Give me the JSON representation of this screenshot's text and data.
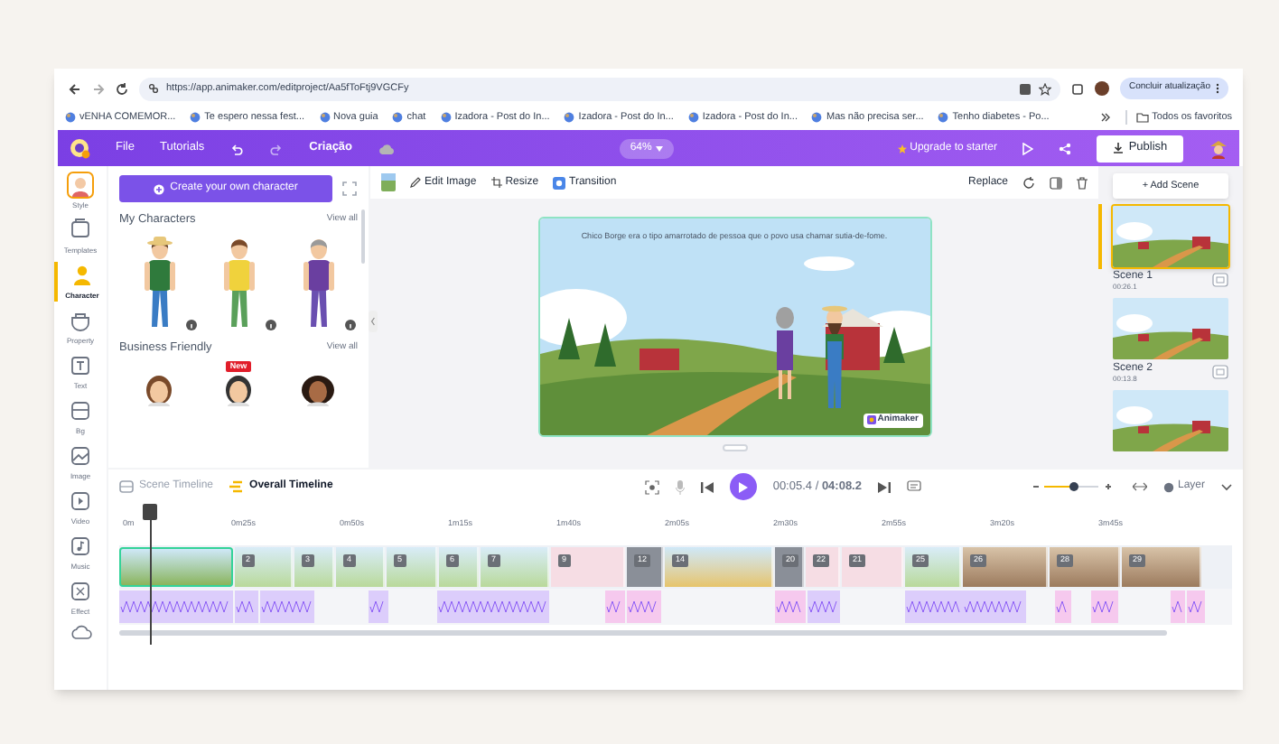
{
  "browser": {
    "url": "https://app.animaker.com/editproject/Aa5fToFtj9VGCFy",
    "update_button": "Concluir atualização",
    "bookmarks": [
      {
        "label": "vENHA COMEMOR..."
      },
      {
        "label": "Te espero nessa fest..."
      },
      {
        "label": "Nova guia"
      },
      {
        "label": "chat"
      },
      {
        "label": "Izadora - Post do In..."
      },
      {
        "label": "Izadora - Post do In..."
      },
      {
        "label": "Izadora - Post do In..."
      },
      {
        "label": "Mas não precisa ser..."
      },
      {
        "label": "Tenho diabetes - Po..."
      }
    ],
    "all_bookmarks": "Todos os favoritos"
  },
  "menu": {
    "items": [
      "File",
      "Tutorials"
    ],
    "project": "Criação",
    "zoom": "64%",
    "upgrade": "Upgrade to starter",
    "publish": "Publish"
  },
  "rail": [
    {
      "label": "Style",
      "selected": false
    },
    {
      "label": "Templates",
      "selected": false
    },
    {
      "label": "Character",
      "selected": true
    },
    {
      "label": "Property",
      "selected": false
    },
    {
      "label": "Text",
      "selected": false
    },
    {
      "label": "Bg",
      "selected": false
    },
    {
      "label": "Image",
      "selected": false
    },
    {
      "label": "Video",
      "selected": false
    },
    {
      "label": "Music",
      "selected": false
    },
    {
      "label": "Effect",
      "selected": false
    }
  ],
  "panel": {
    "create_button": "Create your own character",
    "sections": [
      {
        "title": "My Characters",
        "view_all": "View all"
      },
      {
        "title": "Business Friendly",
        "view_all": "View all"
      }
    ],
    "new_badge": "New"
  },
  "toolbar": {
    "edit_image": "Edit Image",
    "resize": "Resize",
    "transition": "Transition",
    "replace": "Replace"
  },
  "canvas": {
    "caption": "Chico Borge era o tipo amarrotado de pessoa que o povo usa chamar sutia-de-fome.",
    "brand": "Animaker"
  },
  "scenes": {
    "add_button": "+ Add Scene",
    "items": [
      {
        "title": "Scene 1",
        "duration": "00:26.1",
        "selected": true
      },
      {
        "title": "Scene 2",
        "duration": "00:13.8",
        "selected": false
      },
      {
        "selected": false
      }
    ]
  },
  "timeline": {
    "tabs": [
      {
        "label": "Scene Timeline",
        "selected": false
      },
      {
        "label": "Overall Timeline",
        "selected": true
      }
    ],
    "time": "00:05.4 / **04:08.2**",
    "zoom": {
      "level": 0.55
    },
    "layer": "Layer",
    "ticks": [
      "0m",
      "0m25s",
      "0m50s",
      "1m15s",
      "1m40s",
      "2m05s",
      "2m30s",
      "2m55s",
      "3m20s",
      "3m45s"
    ],
    "clips": [
      {
        "kind": "farm",
        "selected": true
      },
      {
        "label": "2",
        "kind": "sky",
        "selected": false
      },
      {
        "label": "3",
        "kind": "sky",
        "selected": false
      },
      {
        "label": "4",
        "kind": "sky",
        "selected": false
      },
      {
        "label": "5",
        "kind": "sky",
        "selected": false
      },
      {
        "label": "6",
        "kind": "sky",
        "selected": false
      },
      {
        "label": "7",
        "kind": "sky",
        "selected": false
      },
      {
        "label": "9",
        "kind": "pink",
        "selected": false
      },
      {
        "label": "12",
        "kind": "grey",
        "selected": false
      },
      {
        "label": "14",
        "kind": "beach",
        "selected": false
      },
      {
        "label": "20",
        "kind": "grey",
        "selected": false
      },
      {
        "label": "22",
        "kind": "pink",
        "selected": false
      },
      {
        "label": "21",
        "kind": "pink",
        "selected": false
      },
      {
        "label": "25",
        "kind": "sky",
        "selected": false
      },
      {
        "label": "26",
        "kind": "room",
        "selected": false
      },
      {
        "label": "28",
        "kind": "room",
        "selected": false
      },
      {
        "label": "29",
        "kind": "room",
        "selected": false
      }
    ]
  }
}
